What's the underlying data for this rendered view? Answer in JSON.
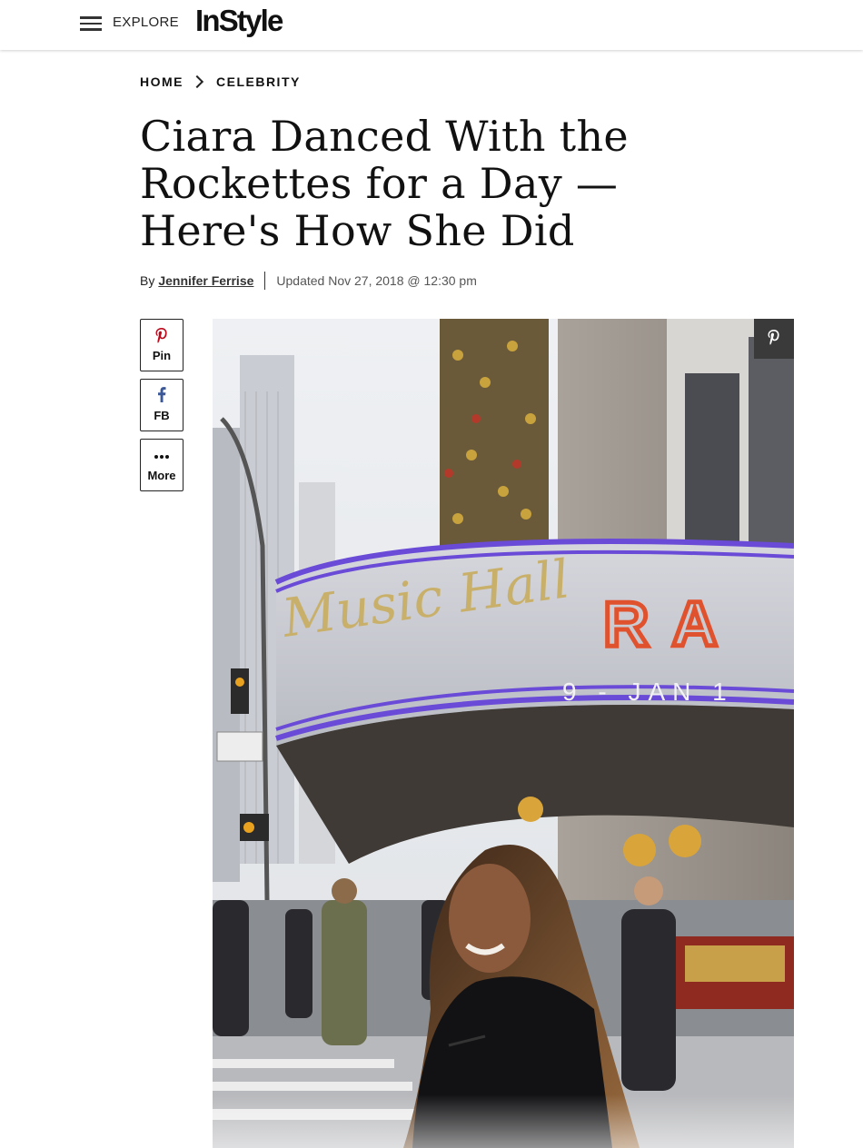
{
  "header": {
    "explore_label": "EXPLORE",
    "logo_text": "InStyle"
  },
  "breadcrumb": {
    "items": [
      "HOME",
      "CELEBRITY"
    ]
  },
  "article": {
    "title": "Ciara Danced With the Rockettes for a Day — Here's How She Did",
    "by_label": "By",
    "author": "Jennifer Ferrise",
    "updated": "Updated Nov 27, 2018 @ 12:30 pm"
  },
  "share": [
    {
      "label": "Pin",
      "icon": "pinterest-icon"
    },
    {
      "label": "FB",
      "icon": "facebook-icon"
    },
    {
      "label": "More",
      "icon": "more-dots-icon"
    }
  ],
  "photo": {
    "marquee_script": "Music Hall",
    "marquee_letters": "RA",
    "marquee_sub": "9 - JAN 1"
  },
  "colors": {
    "accent_pinterest": "#bd081c",
    "facebook": "#3b5998",
    "text": "#111111"
  }
}
